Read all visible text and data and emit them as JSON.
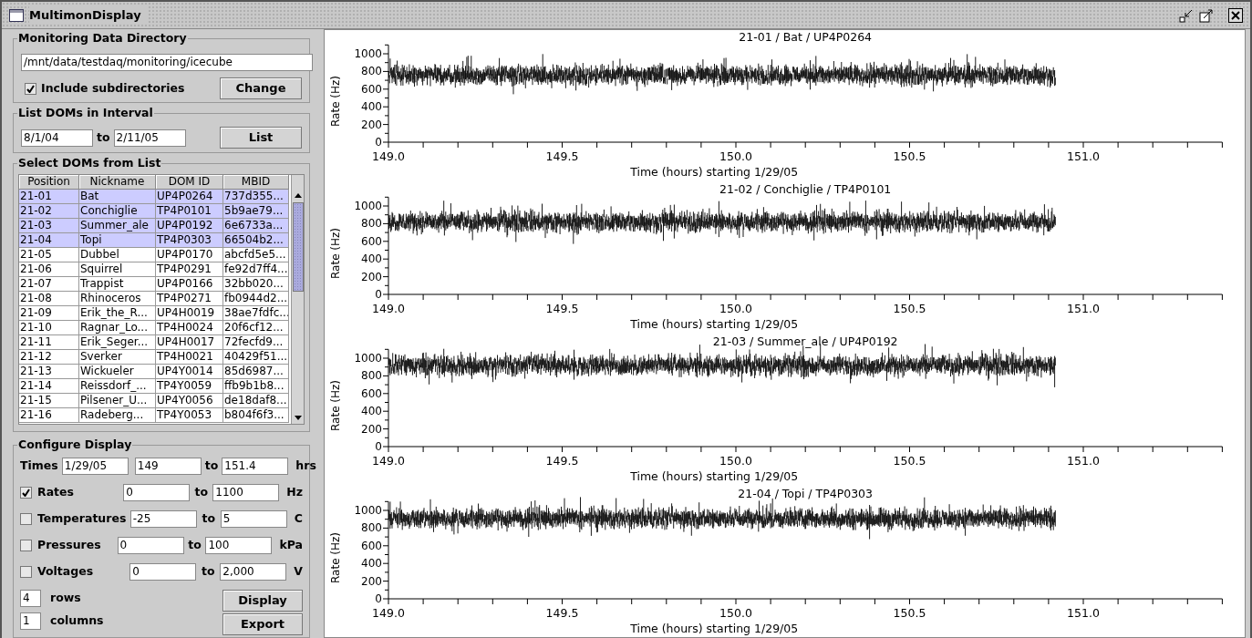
{
  "window": {
    "title": "MultimonDisplay"
  },
  "directory": {
    "title": "Monitoring Data Directory",
    "path": "/mnt/data/testdaq/monitoring/icecube",
    "include": {
      "label": "Include subdirectories",
      "checked": true
    },
    "button": "Change"
  },
  "interval": {
    "title": "List DOMs in Interval",
    "from": "8/1/04",
    "to_label": "to",
    "to": "2/11/05",
    "button": "List"
  },
  "dom_list": {
    "title": "Select DOMs from List",
    "columns": [
      "Position",
      "Nickname",
      "DOM ID",
      "MBID"
    ],
    "rows": [
      {
        "cells": [
          "21-01",
          "Bat",
          "UP4P0264",
          "737d355..."
        ],
        "selected": true
      },
      {
        "cells": [
          "21-02",
          "Conchiglie",
          "TP4P0101",
          "5b9ae79..."
        ],
        "selected": true
      },
      {
        "cells": [
          "21-03",
          "Summer_ale",
          "UP4P0192",
          "6e6733a..."
        ],
        "selected": true
      },
      {
        "cells": [
          "21-04",
          "Topi",
          "TP4P0303",
          "66504b2..."
        ],
        "selected": true
      },
      {
        "cells": [
          "21-05",
          "Dubbel",
          "UP4P0170",
          "abcfd5e5..."
        ],
        "selected": false
      },
      {
        "cells": [
          "21-06",
          "Squirrel",
          "TP4P0291",
          "fe92d7ff4..."
        ],
        "selected": false
      },
      {
        "cells": [
          "21-07",
          "Trappist",
          "UP4P0166",
          "32bb020..."
        ],
        "selected": false
      },
      {
        "cells": [
          "21-08",
          "Rhinoceros",
          "TP4P0271",
          "fb0944d2..."
        ],
        "selected": false
      },
      {
        "cells": [
          "21-09",
          "Erik_the_R...",
          "UP4H0019",
          "38ae7fdfc..."
        ],
        "selected": false
      },
      {
        "cells": [
          "21-10",
          "Ragnar_Lo...",
          "TP4H0024",
          "20f6cf12..."
        ],
        "selected": false
      },
      {
        "cells": [
          "21-11",
          "Erik_Seger...",
          "UP4H0017",
          "72fecfd9..."
        ],
        "selected": false
      },
      {
        "cells": [
          "21-12",
          "Sverker",
          "TP4H0021",
          "40429f51..."
        ],
        "selected": false
      },
      {
        "cells": [
          "21-13",
          "Wickueler",
          "UP4Y0014",
          "85d6987..."
        ],
        "selected": false
      },
      {
        "cells": [
          "21-14",
          "Reissdorf_...",
          "TP4Y0059",
          "ffb9b1b8..."
        ],
        "selected": false
      },
      {
        "cells": [
          "21-15",
          "Pilsener_U...",
          "UP4Y0056",
          "de18daf8..."
        ],
        "selected": false
      },
      {
        "cells": [
          "21-16",
          "Radeberg...",
          "TP4Y0053",
          "b804f6f3..."
        ],
        "selected": false
      }
    ]
  },
  "configure": {
    "title": "Configure Display",
    "times": {
      "label": "Times",
      "date": "1/29/05",
      "from": "149",
      "to_label": "to",
      "to": "151.4",
      "unit": "hrs"
    },
    "measures": [
      {
        "label": "Rates",
        "checked": true,
        "from": "0",
        "to_label": "to",
        "to": "1100",
        "unit": "Hz"
      },
      {
        "label": "Temperatures",
        "checked": false,
        "from": "-25",
        "to_label": "to",
        "to": "5",
        "unit": "C"
      },
      {
        "label": "Pressures",
        "checked": false,
        "from": "0",
        "to_label": "to",
        "to": "100",
        "unit": "kPa"
      },
      {
        "label": "Voltages",
        "checked": false,
        "from": "0",
        "to_label": "to",
        "to": "2,000",
        "unit": "V"
      }
    ],
    "grid": [
      {
        "value": "4",
        "label": "rows"
      },
      {
        "value": "1",
        "label": "columns"
      }
    ],
    "buttons": [
      "Display",
      "Export"
    ]
  },
  "plots": [
    {
      "title": "21-01 / Bat / UP4P0264",
      "ylabel": "Rate (Hz)",
      "xlabel": "Time (hours) starting 1/29/05",
      "yticks": [
        "1000",
        "800",
        "600",
        "400",
        "200",
        "0"
      ],
      "xticks": [
        "149.0",
        "149.5",
        "150.0",
        "150.5",
        "151.0"
      ]
    },
    {
      "title": "21-02 / Conchiglie / TP4P0101",
      "ylabel": "Rate (Hz)",
      "xlabel": "Time (hours) starting 1/29/05",
      "yticks": [
        "1000",
        "800",
        "600",
        "400",
        "200",
        "0"
      ],
      "xticks": [
        "149.0",
        "149.5",
        "150.0",
        "150.5",
        "151.0"
      ]
    },
    {
      "title": "21-03 / Summer_ale / UP4P0192",
      "ylabel": "Rate (Hz)",
      "xlabel": "Time (hours) starting 1/29/05",
      "yticks": [
        "1000",
        "800",
        "600",
        "400",
        "200",
        "0"
      ],
      "xticks": [
        "149.0",
        "149.5",
        "150.0",
        "150.5",
        "151.0"
      ]
    },
    {
      "title": "21-04 / Topi / TP4P0303",
      "ylabel": "Rate (Hz)",
      "xlabel": "Time (hours) starting 1/29/05",
      "yticks": [
        "1000",
        "800",
        "600",
        "400",
        "200",
        "0"
      ],
      "xticks": [
        "149.0",
        "149.5",
        "150.0",
        "150.5",
        "151.0"
      ]
    }
  ]
}
